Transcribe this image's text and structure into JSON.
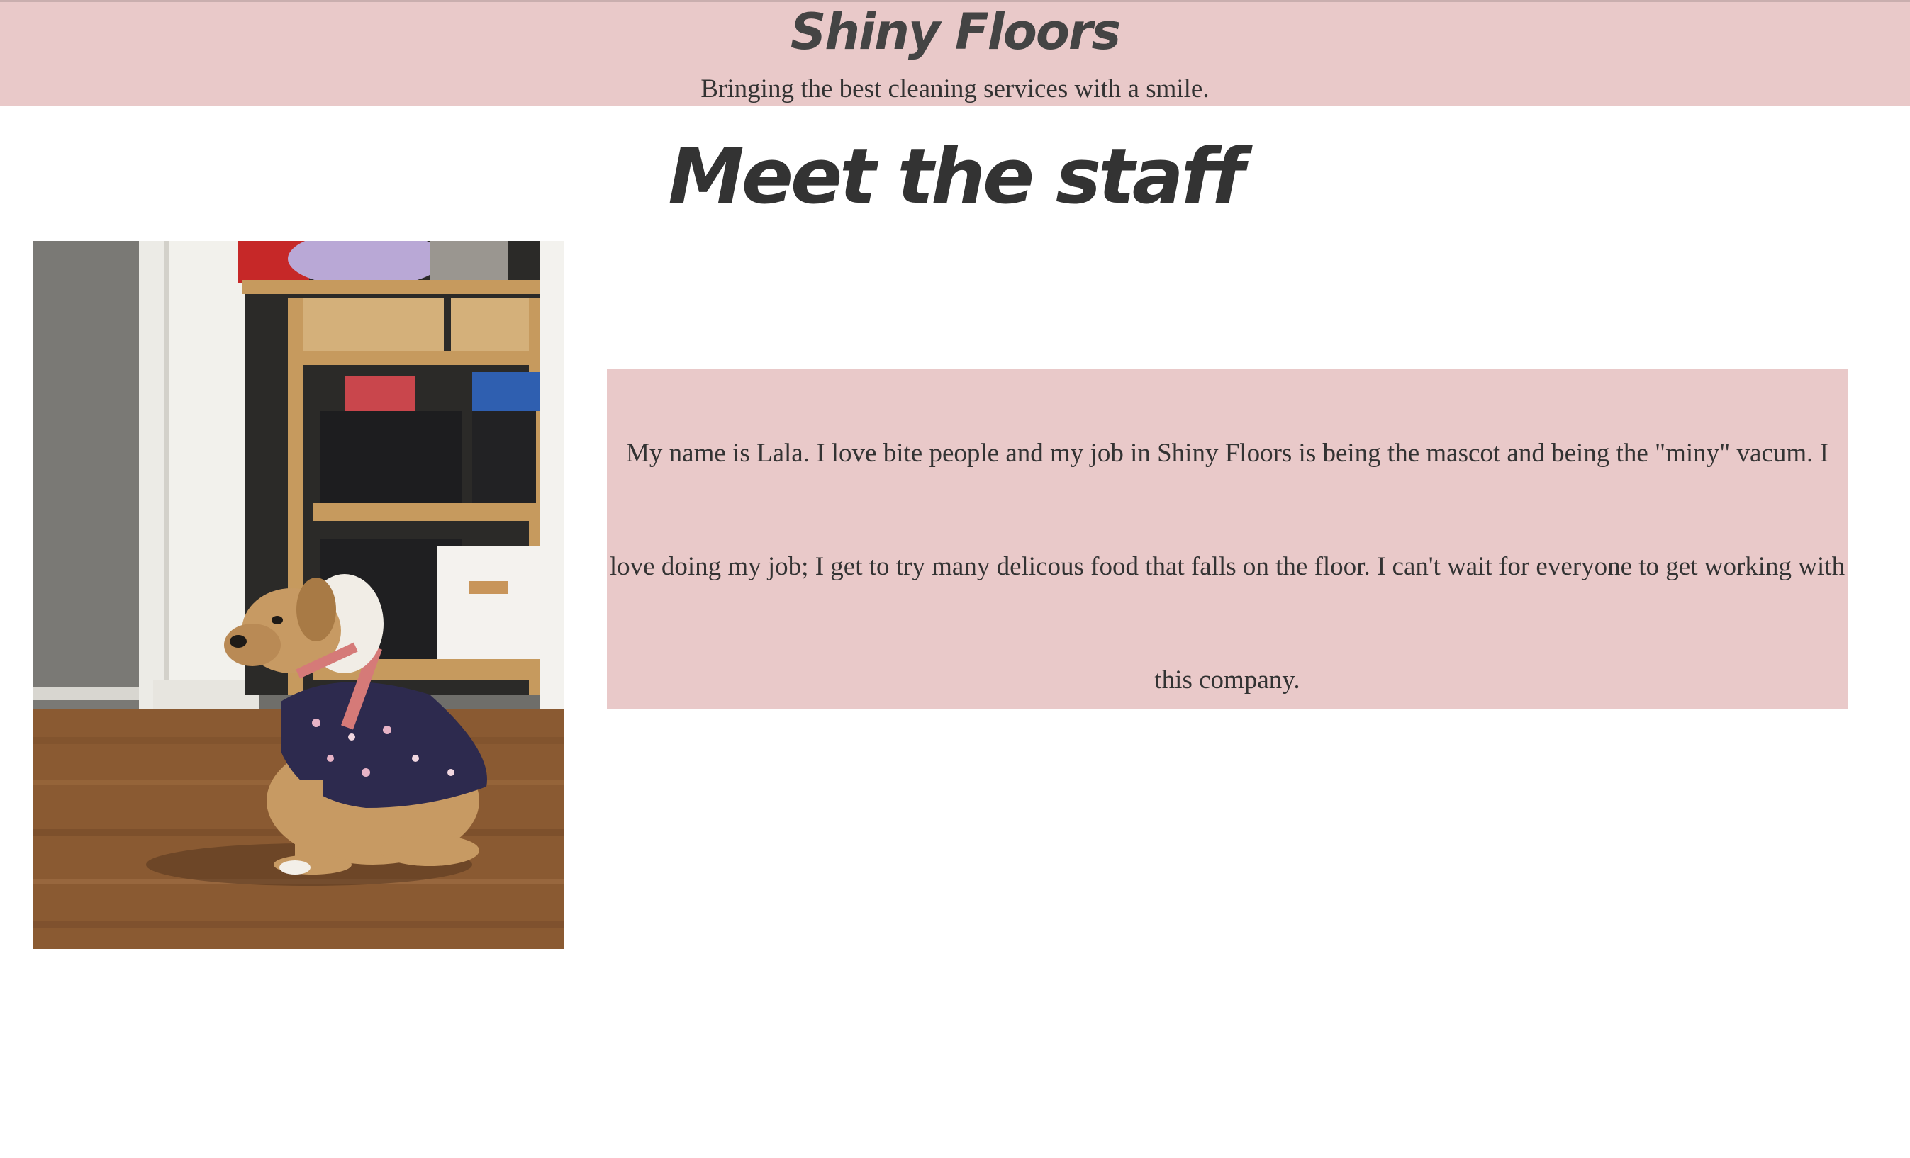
{
  "header": {
    "title": "Shiny Floors",
    "tagline": "Bringing the best cleaning services with a smile."
  },
  "main": {
    "section_title": "Meet the staff",
    "staff": [
      {
        "bio": "My name is Lala. I love bite people and my job in Shiny Floors is being the mascot and being the \"miny\" vacum. I love doing my job; I get to try many delicous food that falls on the floor. I can't wait for everyone to get working with this company."
      }
    ]
  },
  "colors": {
    "header_background": "#e9c9c9",
    "bio_background": "#e9c9c9",
    "text": "#333333"
  }
}
